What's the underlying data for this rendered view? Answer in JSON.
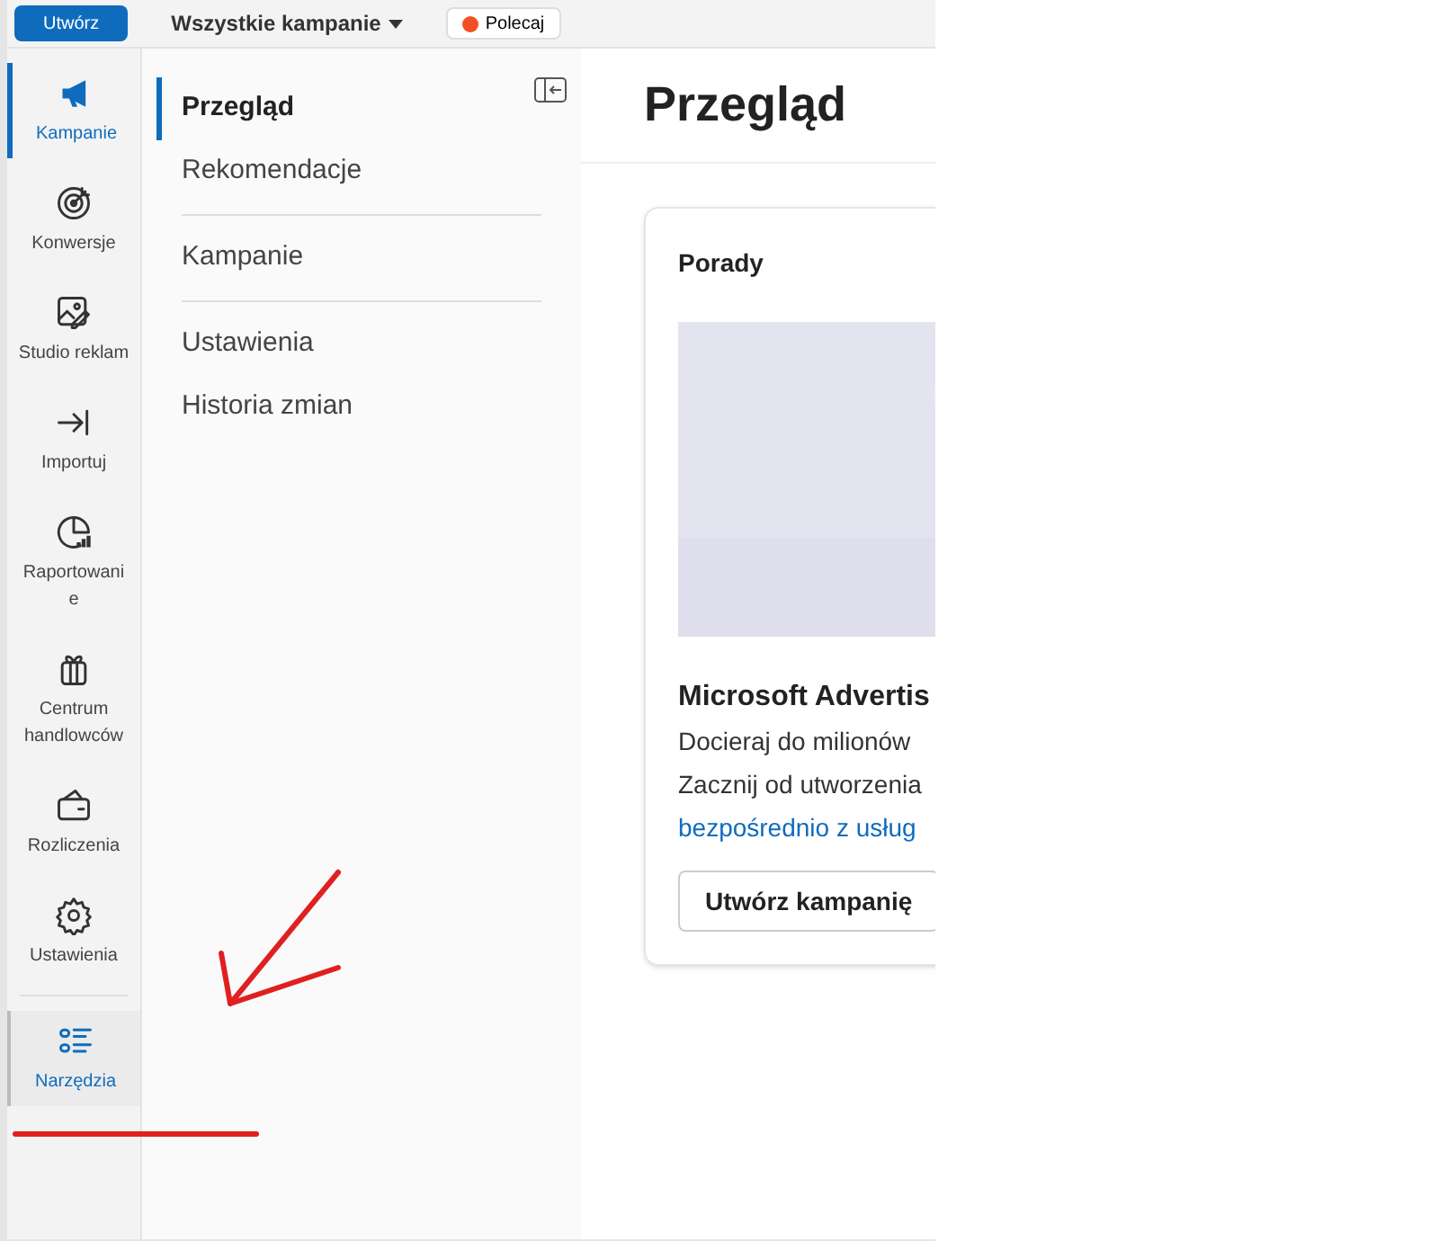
{
  "top_bar": {
    "create_button": "Utwórz",
    "campaign_picker": "Wszystkie kampanie",
    "refer_button": "Polecaj"
  },
  "rail": [
    {
      "kind": "megaphone",
      "label": "Kampanie",
      "selected": true,
      "highlighted": false
    },
    {
      "kind": "target",
      "label": "Konwersje",
      "selected": false,
      "highlighted": false
    },
    {
      "kind": "image-edit",
      "label": "Studio reklam",
      "selected": false,
      "highlighted": false
    },
    {
      "kind": "import",
      "label": "Importuj",
      "selected": false,
      "highlighted": false
    },
    {
      "kind": "report",
      "label": "Raportowani e",
      "selected": false,
      "highlighted": false
    },
    {
      "kind": "gift",
      "label": "Centrum handlowców",
      "selected": false,
      "highlighted": false
    },
    {
      "kind": "wallet",
      "label": "Rozliczenia",
      "selected": false,
      "highlighted": false
    },
    {
      "kind": "gear",
      "label": "Ustawienia",
      "selected": false,
      "highlighted": false
    },
    {
      "kind": "list",
      "label": "Narzędzia",
      "selected": false,
      "highlighted": true
    }
  ],
  "subnav": [
    {
      "label": "Przegląd",
      "selected": true
    },
    {
      "label": "Rekomendacje",
      "selected": false
    },
    {
      "label": "Kampanie",
      "selected": false
    },
    {
      "label": "Ustawienia",
      "selected": false
    },
    {
      "label": "Historia zmian",
      "selected": false
    }
  ],
  "page_title": "Przegląd",
  "tips_card": {
    "title": "Porady",
    "heading": "Microsoft Advertis",
    "lines": [
      "Docieraj do milionów",
      "Zacznij od utworzenia"
    ],
    "link": "bezpośrednio z usług",
    "button": "Utwórz kampanię"
  }
}
